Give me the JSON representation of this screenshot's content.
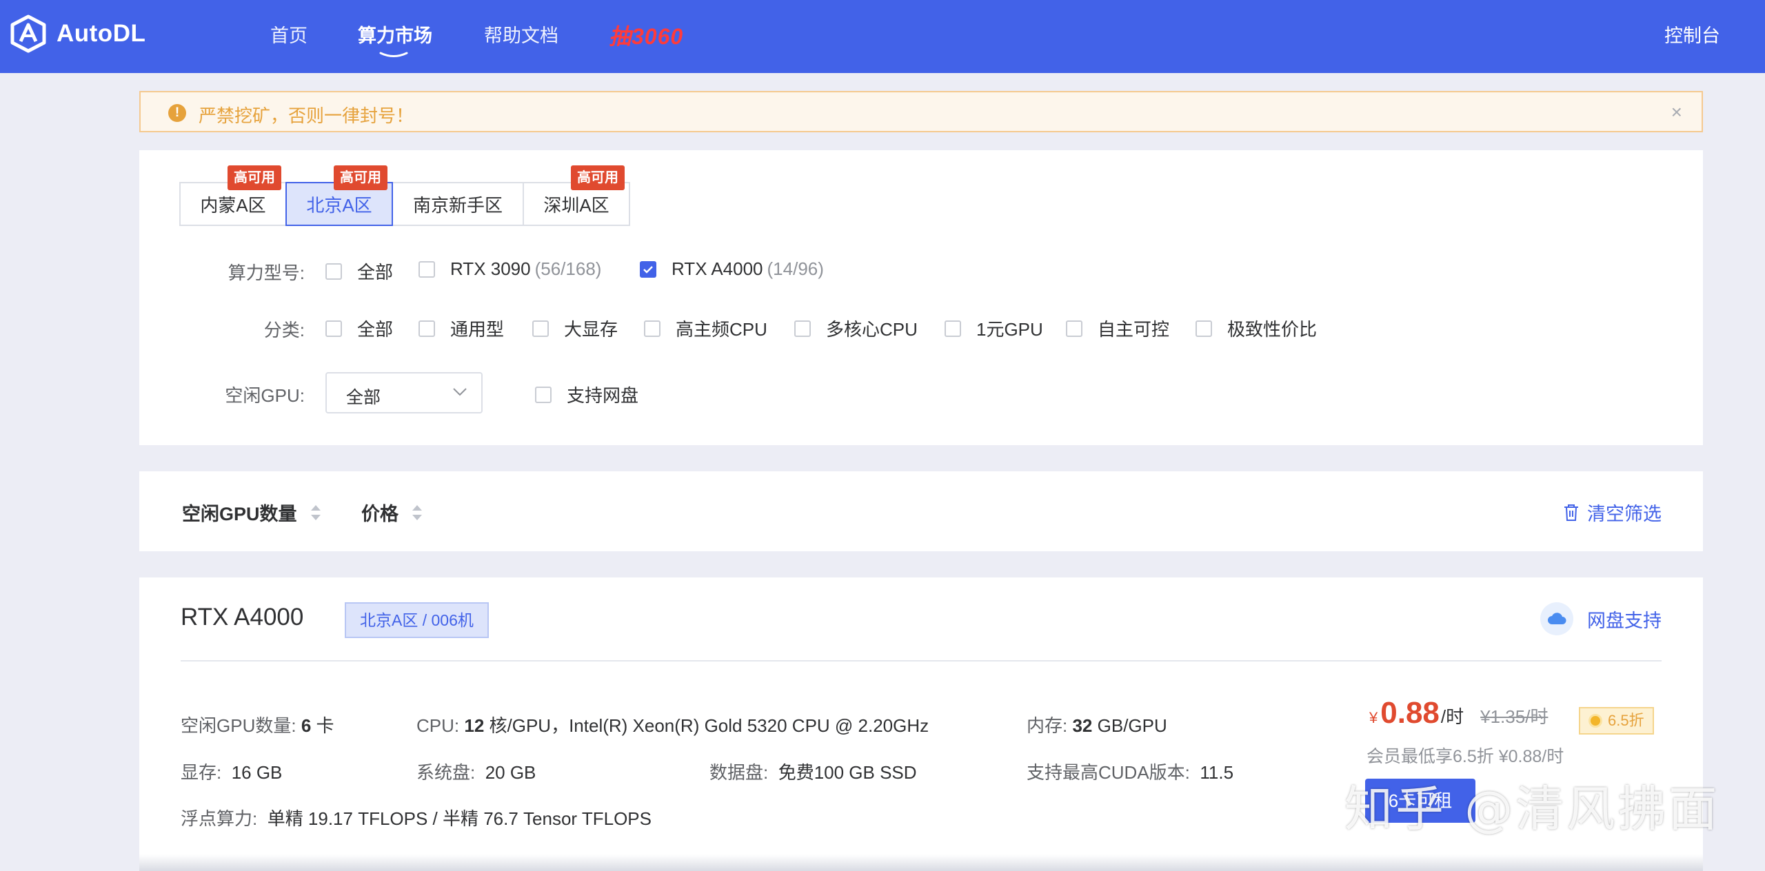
{
  "header": {
    "logo_text": "AutoDL",
    "nav": [
      {
        "label": "首页"
      },
      {
        "label": "算力市场"
      },
      {
        "label": "帮助文档"
      }
    ],
    "promo": "抽3060",
    "console": "控制台",
    "colors": {
      "bar": "#4262e8",
      "promo": "#ff3b3b"
    }
  },
  "alert": {
    "text": "严禁挖矿，否则一律封号！",
    "icon": "warning-icon",
    "close": "×"
  },
  "filters": {
    "regions": [
      {
        "label": "内蒙A区",
        "badge": "高可用",
        "selected": false
      },
      {
        "label": "北京A区",
        "badge": "高可用",
        "selected": true
      },
      {
        "label": "南京新手区",
        "badge": "",
        "selected": false
      },
      {
        "label": "深圳A区",
        "badge": "高可用",
        "selected": false
      }
    ],
    "gpu_type": {
      "label": "算力型号:",
      "options": [
        {
          "label": "全部",
          "count": "",
          "checked": false
        },
        {
          "label": "RTX 3090",
          "count": "(56/168)",
          "checked": false
        },
        {
          "label": "RTX A4000",
          "count": "(14/96)",
          "checked": true
        }
      ]
    },
    "category": {
      "label": "分类:",
      "options": [
        "全部",
        "通用型",
        "大显存",
        "高主频CPU",
        "多核心CPU",
        "1元GPU",
        "自主可控",
        "极致性价比"
      ]
    },
    "idle_gpu": {
      "label": "空闲GPU:",
      "value": "全部"
    },
    "netdisk": {
      "label": "支持网盘",
      "checked": false
    }
  },
  "sort": {
    "items": [
      "空闲GPU数量",
      "价格"
    ],
    "clear": "清空筛选"
  },
  "machine": {
    "gpu": "RTX A4000",
    "zone": "北京A区 / 006机",
    "netdisk": "网盘支持",
    "specs": {
      "idle_label": "空闲GPU数量:",
      "idle_value": "6",
      "idle_unit": "卡",
      "cpu_label": "CPU:",
      "cpu_cores": "12",
      "cpu_rest": "核/GPU，Intel(R) Xeon(R) Gold 5320 CPU @ 2.20GHz",
      "mem_label": "内存:",
      "mem_value": "32",
      "mem_unit": "GB/GPU",
      "vram_label": "显存:",
      "vram_value": "16 GB",
      "sysdisk_label": "系统盘:",
      "sysdisk_value": "20 GB",
      "datadisk_label": "数据盘:",
      "datadisk_value": "免费100 GB SSD",
      "cuda_label": "支持最高CUDA版本:",
      "cuda_value": "11.5",
      "flops_label": "浮点算力:",
      "flops_value": "单精 19.17 TFLOPS / 半精 76.7 Tensor TFLOPS"
    },
    "price": {
      "currency": "¥",
      "now": "0.88",
      "per": "/时",
      "old": "¥1.35/时",
      "discount": "6.5折",
      "member": "会员最低享6.5折 ¥0.88/时"
    },
    "rent_button": "6卡可租"
  },
  "watermark": "知乎 @清风拂面"
}
